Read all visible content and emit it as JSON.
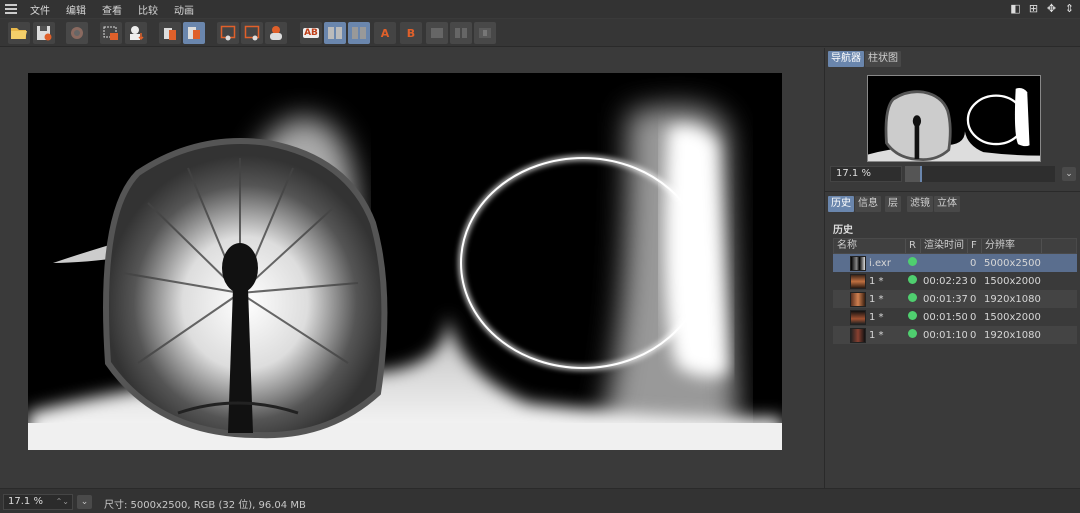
{
  "menu": {
    "items": [
      "文件",
      "编辑",
      "查看",
      "比较",
      "动画"
    ]
  },
  "toolbar": {
    "ab_label": "AB",
    "a_label": "A",
    "b_label": "B"
  },
  "navigator": {
    "tabs": [
      "导航器",
      "柱状图"
    ],
    "zoom_value": "17.1 %",
    "slider_fraction": 0.1
  },
  "history_panel": {
    "tabs": [
      "历史",
      "信息",
      "层",
      "滤镜",
      "立体"
    ],
    "title": "历史",
    "columns": [
      "名称",
      "R",
      "渲染时间",
      "F",
      "分辨率"
    ],
    "rows": [
      {
        "name": "i.exr",
        "time": "",
        "f": "0",
        "res": "5000x2500",
        "selected": true
      },
      {
        "name": "1 *",
        "time": "00:02:23",
        "f": "0",
        "res": "1500x2000",
        "selected": false
      },
      {
        "name": "1 *",
        "time": "00:01:37",
        "f": "0",
        "res": "1920x1080",
        "selected": false
      },
      {
        "name": "1 *",
        "time": "00:01:50",
        "f": "0",
        "res": "1500x2000",
        "selected": false
      },
      {
        "name": "1 *",
        "time": "00:01:10",
        "f": "0",
        "res": "1920x1080",
        "selected": false
      }
    ]
  },
  "status": {
    "zoom": "17.1 %",
    "info": "尺寸: 5000x2500, RGB (32 位), 96.04 MB"
  },
  "colors": {
    "accent": "#6a86ad",
    "status_dot": "#4fcf6f",
    "icon_orange": "#e0602a"
  }
}
